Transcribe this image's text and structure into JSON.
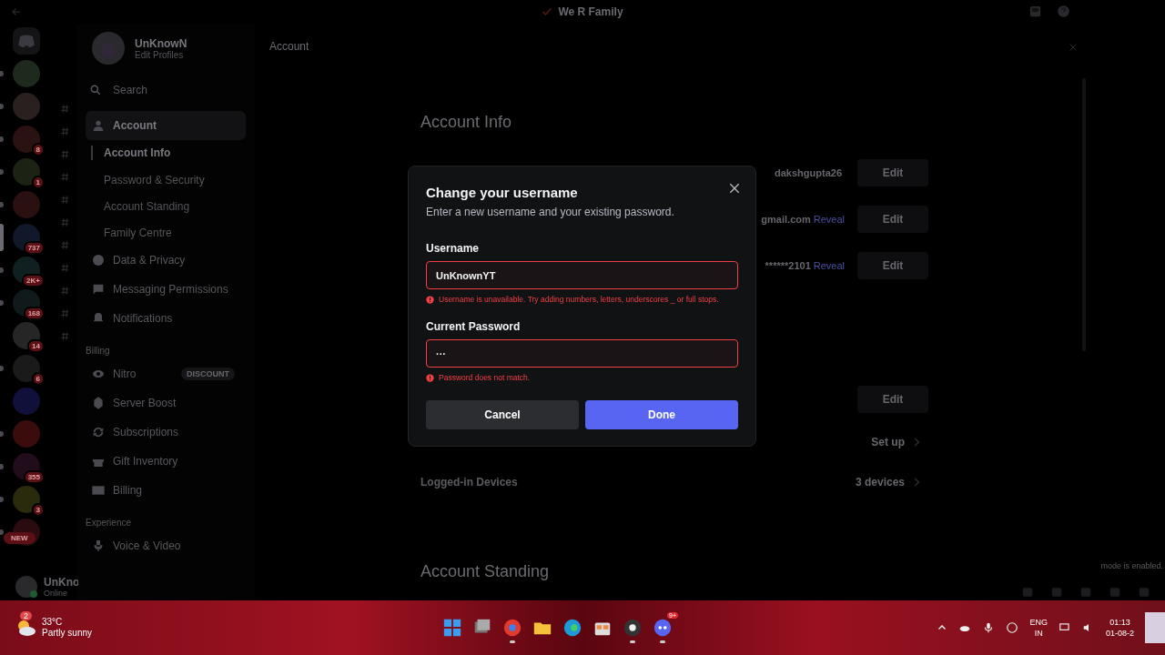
{
  "title_bar": {
    "title": "We R Family"
  },
  "servers": [
    {
      "selected": false,
      "unread": true
    },
    {
      "selected": false,
      "unread": true
    },
    {
      "selected": false,
      "unread": true,
      "badge": "8"
    },
    {
      "selected": false,
      "unread": true,
      "badge": "1"
    },
    {
      "selected": false,
      "unread": true
    },
    {
      "selected": true,
      "badge": "737"
    },
    {
      "selected": false,
      "unread": true,
      "badge": "2K+"
    },
    {
      "selected": false,
      "unread": true,
      "badge": "168"
    },
    {
      "selected": false,
      "unread": false,
      "badge": "14"
    },
    {
      "selected": false,
      "unread": true,
      "badge": "6"
    },
    {
      "selected": false,
      "unread": false
    },
    {
      "selected": false,
      "unread": true
    },
    {
      "selected": false,
      "unread": true,
      "badge": "355"
    },
    {
      "selected": false,
      "unread": true,
      "badge": "3"
    },
    {
      "selected": false,
      "unread": true,
      "badge": "NEW"
    }
  ],
  "user_panel": {
    "name": "UnKno",
    "status": "Online"
  },
  "settings_sidebar": {
    "profile": {
      "name": "UnKnowN",
      "link": "Edit Profiles"
    },
    "search": {
      "placeholder": "Search"
    },
    "sections": [
      {
        "items": [
          {
            "label": "Account",
            "selected": true,
            "children": [
              {
                "label": "Account Info",
                "selected": true
              },
              {
                "label": "Password & Security",
                "selected": false
              },
              {
                "label": "Account Standing",
                "selected": false
              },
              {
                "label": "Family Centre",
                "selected": false
              }
            ]
          },
          {
            "label": "Data & Privacy",
            "selected": false
          },
          {
            "label": "Messaging Permissions",
            "selected": false
          },
          {
            "label": "Notifications",
            "selected": false
          }
        ]
      },
      {
        "heading": "Billing",
        "items": [
          {
            "label": "Nitro",
            "selected": false,
            "badge": "DISCOUNT"
          },
          {
            "label": "Server Boost",
            "selected": false
          },
          {
            "label": "Subscriptions",
            "selected": false
          },
          {
            "label": "Gift Inventory",
            "selected": false
          },
          {
            "label": "Billing",
            "selected": false
          }
        ]
      },
      {
        "heading": "Experience",
        "items": [
          {
            "label": "Voice & Video",
            "selected": false
          }
        ]
      }
    ]
  },
  "content": {
    "breadcrumb": "Account",
    "heading": "Account Info",
    "rows": [
      {
        "kind": "field",
        "value": "dakshgupta26",
        "action": "Edit"
      },
      {
        "kind": "field",
        "value": "gmail.com",
        "link": "Reveal",
        "action": "Edit"
      },
      {
        "kind": "field",
        "value": "******2101",
        "link": "Reveal",
        "action": "Edit"
      },
      {
        "kind": "gap"
      },
      {
        "kind": "field",
        "action": "Edit"
      },
      {
        "kind": "nav",
        "value": "Set up"
      },
      {
        "kind": "nav",
        "label": "Logged-in Devices",
        "value": "3 devices"
      }
    ],
    "heading_2": "Account Standing",
    "notice": "mode is enabled."
  },
  "dialog": {
    "title": "Change your username",
    "subtitle": "Enter a new username and your existing password.",
    "fields": [
      {
        "label": "Username",
        "value": "UnKnownYT",
        "invalid": true,
        "error": "Username is unavailable. Try adding numbers, letters, underscores _ or full stops."
      },
      {
        "label": "Current Password",
        "value": "···",
        "invalid": true,
        "error": "Password does not match."
      }
    ],
    "cancel": "Cancel",
    "done": "Done"
  },
  "taskbar": {
    "weather": {
      "badge": "2",
      "temp": "33°C",
      "condition": "Partly sunny"
    },
    "apps": [
      {
        "running": false
      },
      {
        "running": false
      },
      {
        "running": true
      },
      {
        "running": false
      },
      {
        "running": false
      },
      {
        "running": false
      },
      {
        "running": true
      },
      {
        "running": true,
        "badge": "9+"
      }
    ],
    "tray": {
      "lang": "ENG",
      "region": "IN",
      "time": "01:13",
      "date": "01-08-2"
    }
  }
}
